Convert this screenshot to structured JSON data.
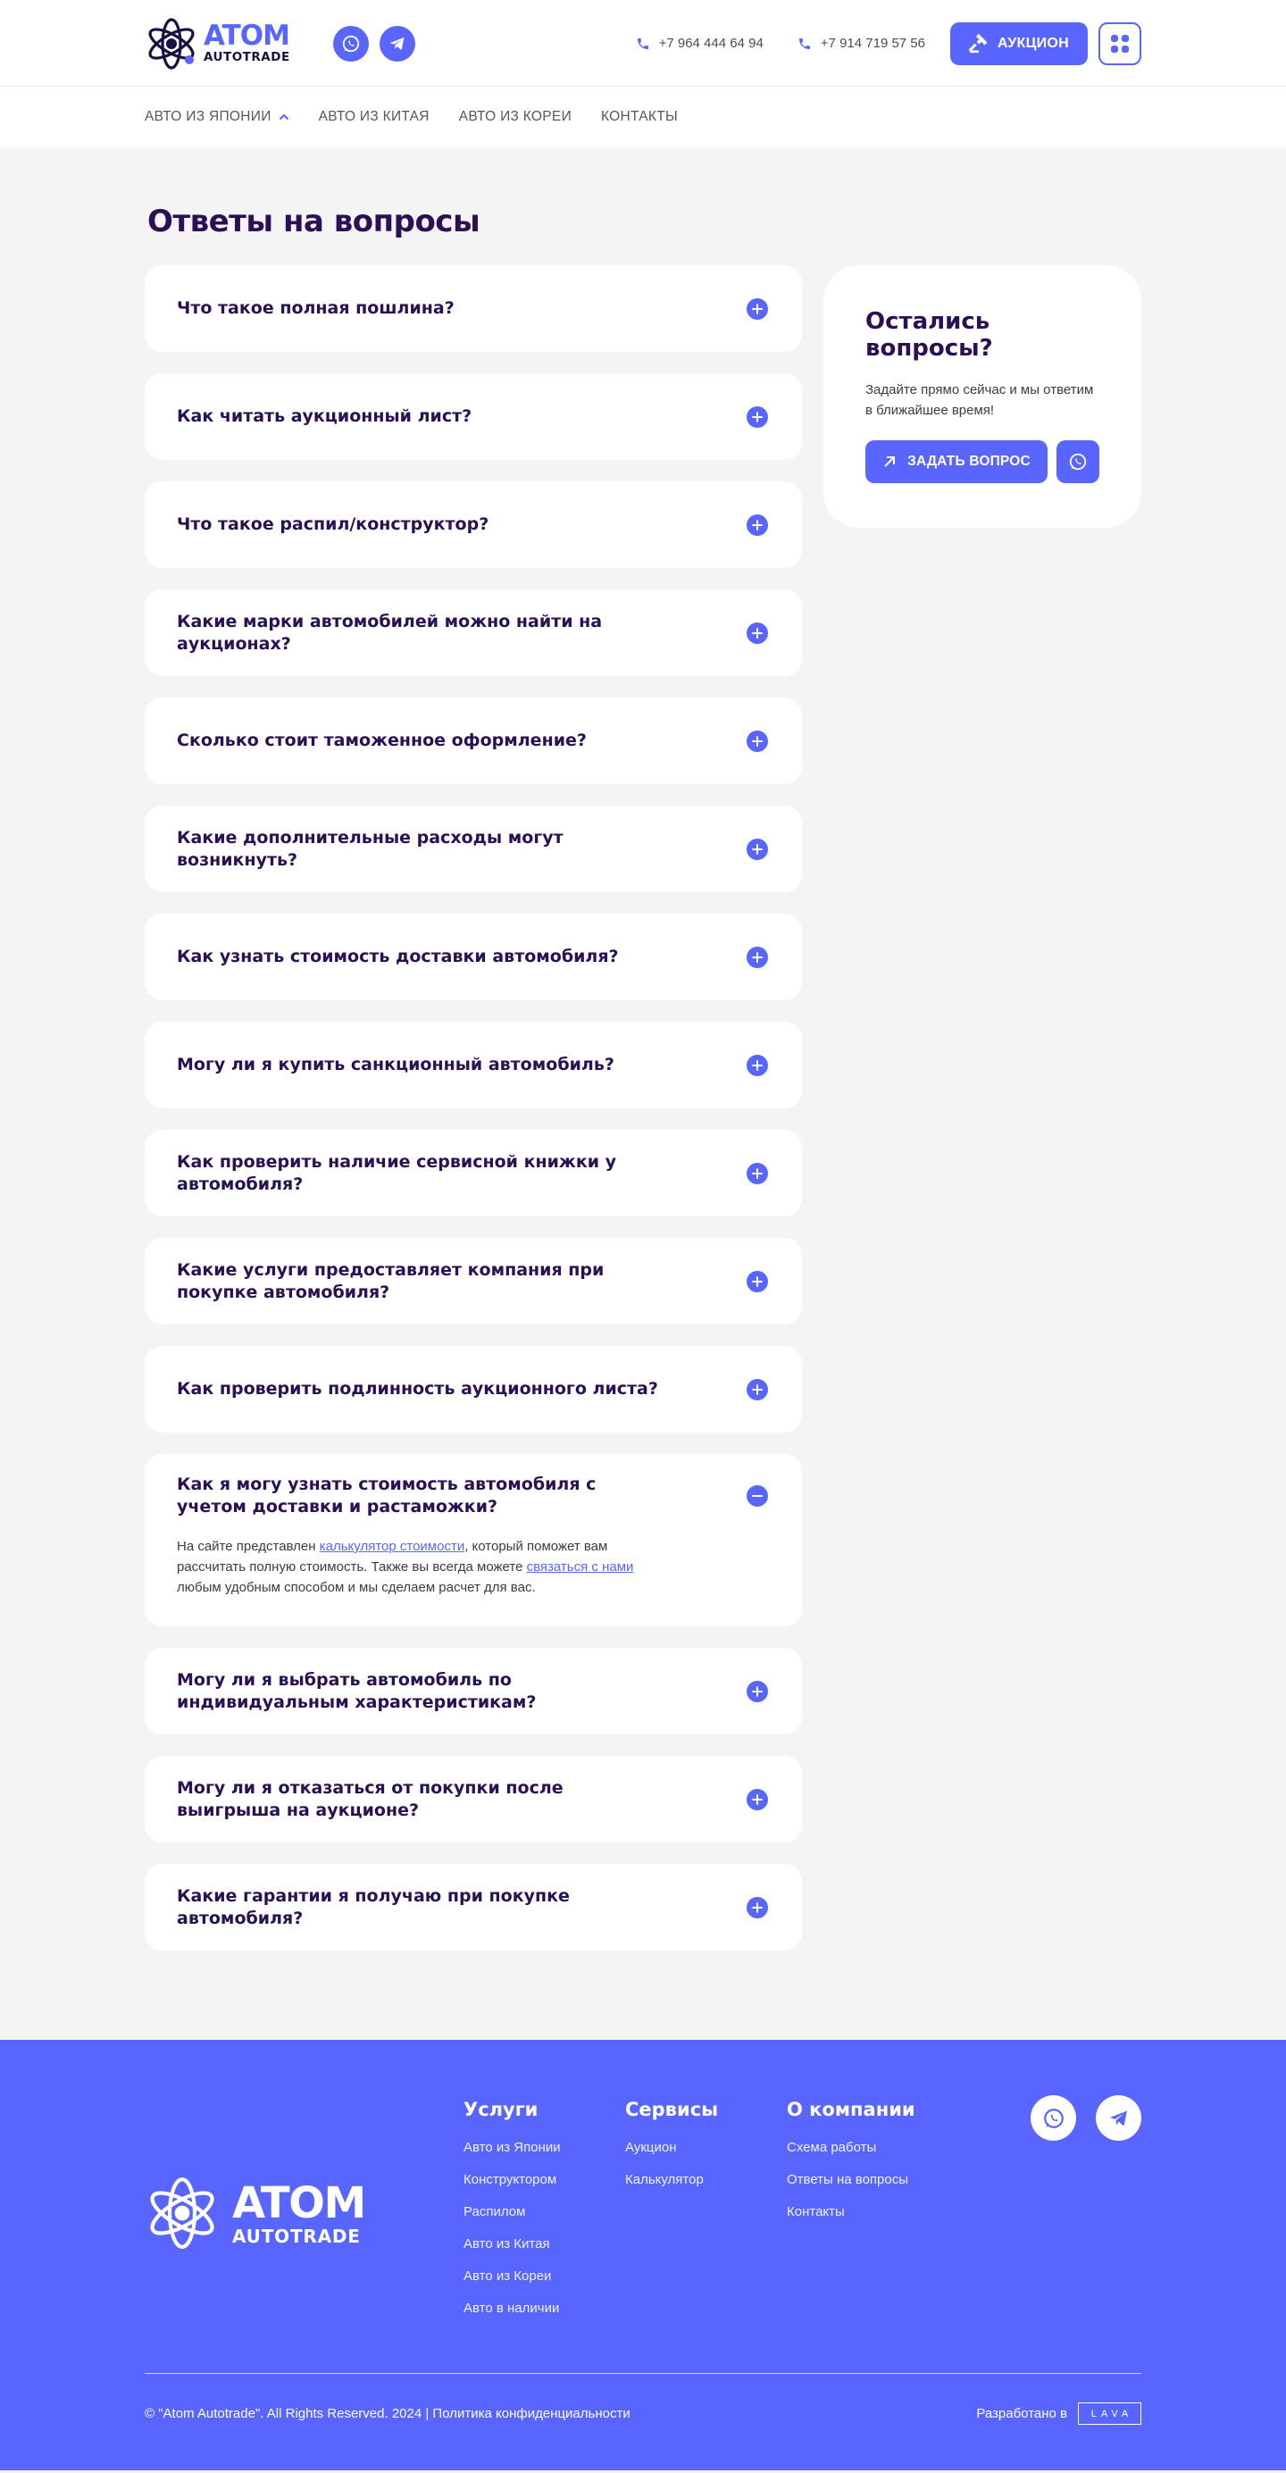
{
  "brand": {
    "name": "ATOM",
    "sub": "AUTOTRADE",
    "accent": "#5865fe",
    "dark": "#2a1055"
  },
  "header": {
    "phones": [
      "+7 964 444 64 94",
      "+7 914 719 57 56"
    ],
    "auction_label": "АУКЦИОН",
    "nav": [
      "АВТО ИЗ ЯПОНИИ",
      "АВТО ИЗ КИТАЯ",
      "АВТО ИЗ КОРЕИ",
      "КОНТАКТЫ"
    ]
  },
  "page_title": "Ответы на вопросы",
  "faq": [
    "Что такое полная пошлина?",
    "Как читать аукционный лист?",
    "Что такое распил/конструктор?",
    "Какие марки автомобилей можно найти на аукционах?",
    "Сколько стоит таможенное оформление?",
    "Какие дополнительные расходы могут возникнуть?",
    "Как узнать стоимость доставки автомобиля?",
    "Могу ли я купить санкционный автомобиль?",
    "Как проверить наличие сервисной книжки у автомобиля?",
    "Какие услуги предоставляет компания при покупке автомобиля?",
    "Как проверить подлинность аукционного листа?",
    "Как я могу узнать стоимость автомобиля с учетом доставки и растаможки?",
    "Могу ли я выбрать автомобиль по индивидуальным характеристикам?",
    "Могу ли я отказаться от покупки после выигрыша на аукционе?",
    "Какие гарантии я получаю при покупке автомобиля?"
  ],
  "faq_answer": {
    "t1": "На сайте представлен ",
    "link1": "калькулятор стоимости",
    "t2": ", который поможет вам рассчитать полную стоимость. Также вы всегда можете ",
    "link2": "связаться с нами",
    "t3": " любым удобным способом и мы сделаем расчет для вас."
  },
  "side_card": {
    "title": "Остались вопросы?",
    "text": "Задайте прямо сейчас и мы ответим в ближайшее время!",
    "button": "ЗАДАТЬ ВОПРОС"
  },
  "footer": {
    "col1": {
      "title": "Услуги",
      "links": [
        "Авто из Японии",
        "Конструктором",
        "Распилом",
        "Авто из Китая",
        "Авто из Кореи",
        "Авто в наличии"
      ]
    },
    "col2": {
      "title": "Сервисы",
      "links": [
        "Аукцион",
        "Калькулятор"
      ]
    },
    "col3": {
      "title": "О компании",
      "links": [
        "Схема работы",
        "Ответы на вопросы",
        "Контакты"
      ]
    },
    "copyright": "©  \"Atom Autotrade\". All Rights Reserved. 2024 | Политика конфиденциальности",
    "developed": "Разработано в",
    "dev_brand": "LAVA"
  }
}
